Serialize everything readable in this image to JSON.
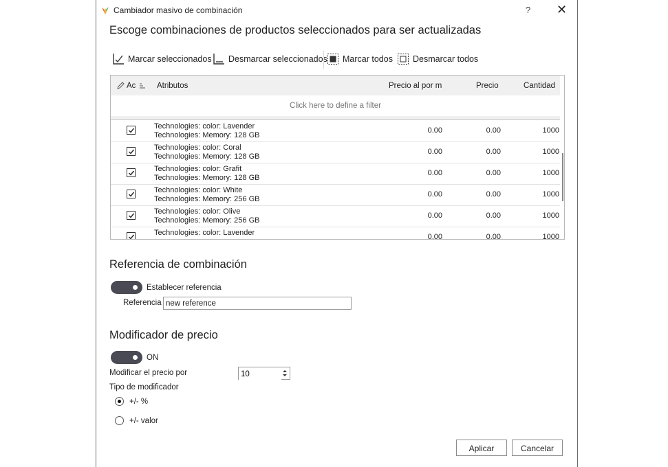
{
  "window": {
    "title": "Cambiador masivo de combinación",
    "help": "?",
    "close": "✕"
  },
  "heading": "Escoge combinaciones de productos seleccionados para ser actualizadas",
  "toolbar": {
    "mark_selected": "Marcar seleccionados",
    "unmark_selected": "Desmarcar seleccionados",
    "mark_all": "Marcar todos",
    "unmark_all": "Desmarcar todos"
  },
  "grid": {
    "columns": {
      "action": "Ac",
      "attributes": "Atributos",
      "retail_price": "Precio al por m",
      "price": "Precio",
      "quantity": "Cantidad"
    },
    "filter_text": "Click here to define a filter",
    "rows": [
      {
        "checked": true,
        "attr1": "Technologies:  color: Lavender",
        "attr2": "Technologies: Memory: 128 GB",
        "retail": "0.00",
        "price": "0.00",
        "qty": "1000"
      },
      {
        "checked": true,
        "attr1": "Technologies:  color: Coral",
        "attr2": "Technologies: Memory: 128 GB",
        "retail": "0.00",
        "price": "0.00",
        "qty": "1000"
      },
      {
        "checked": true,
        "attr1": "Technologies:  color: Grafit",
        "attr2": "Technologies: Memory: 128 GB",
        "retail": "0.00",
        "price": "0.00",
        "qty": "1000"
      },
      {
        "checked": true,
        "attr1": "Technologies:  color: White",
        "attr2": "Technologies: Memory: 256 GB",
        "retail": "0.00",
        "price": "0.00",
        "qty": "1000"
      },
      {
        "checked": true,
        "attr1": "Technologies:  color: Olive",
        "attr2": "Technologies: Memory: 256 GB",
        "retail": "0.00",
        "price": "0.00",
        "qty": "1000"
      },
      {
        "checked": true,
        "attr1": "Technologies:  color: Lavender",
        "attr2": "",
        "retail": "0.00",
        "price": "0.00",
        "qty": "1000"
      }
    ]
  },
  "reference_section": {
    "title": "Referencia de combinación",
    "toggle_label": "Establecer referencia",
    "field_label": "Referencia",
    "field_value": "new reference"
  },
  "price_section": {
    "title": "Modificador de precio",
    "toggle_label": "ON",
    "modify_label": "Modificar el precio por",
    "modify_value": "10",
    "type_label": "Tipo de modificador",
    "option_percent": "+/- %",
    "option_value": "+/- valor",
    "selected": "percent"
  },
  "buttons": {
    "apply": "Aplicar",
    "cancel": "Cancelar"
  },
  "colors": {
    "toggle": "#4a4a55",
    "header_bg": "#f0f0f0",
    "icon_orange": "#e8731a",
    "icon_green": "#4caf50"
  }
}
